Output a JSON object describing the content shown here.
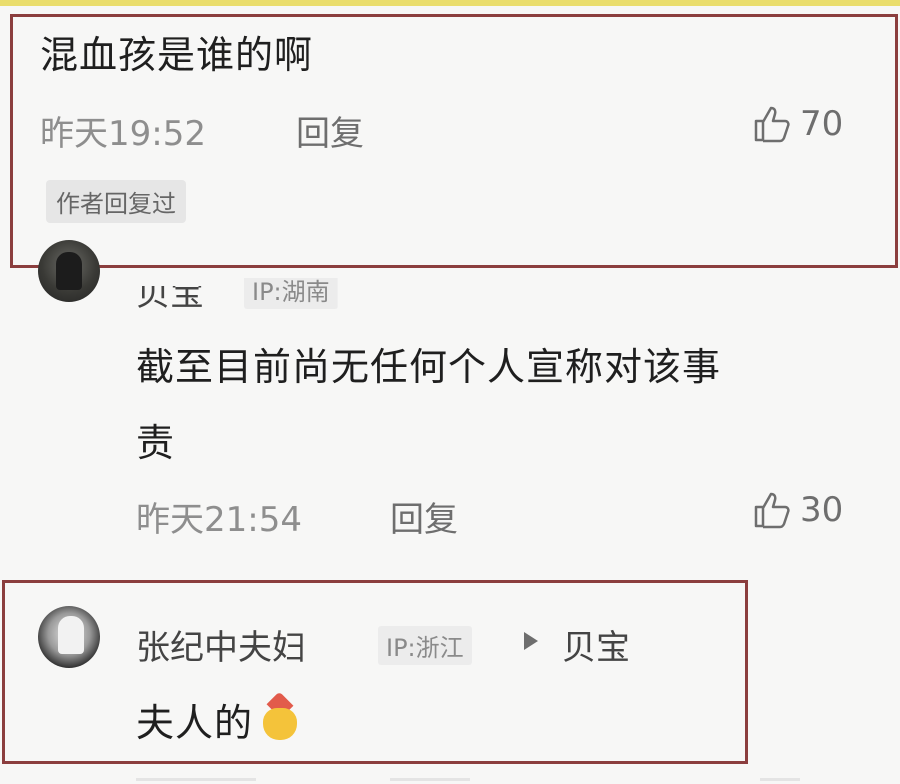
{
  "comments": [
    {
      "text": "混血孩是谁的啊",
      "time": "昨天19:52",
      "reply_label": "回复",
      "likes": "70",
      "author_badge": "作者回复过"
    },
    {
      "username": "贝宝",
      "ip": "IP:湖南",
      "text_line1": "截至目前尚无任何个人宣称对该事",
      "text_line2": "责",
      "time": "昨天21:54",
      "reply_label": "回复",
      "likes": "30"
    },
    {
      "username": "张纪中夫妇",
      "ip": "IP:浙江",
      "reply_to": "贝宝",
      "text": "夫人的"
    }
  ],
  "icons": {
    "like": "thumbs-up-icon",
    "reply_arrow": "play-triangle-icon",
    "emoji": "finger-heart-emoji"
  },
  "colors": {
    "highlight_border": "#8b3e3e",
    "top_bar": "#eadd6c",
    "background": "#f7f7f6"
  }
}
